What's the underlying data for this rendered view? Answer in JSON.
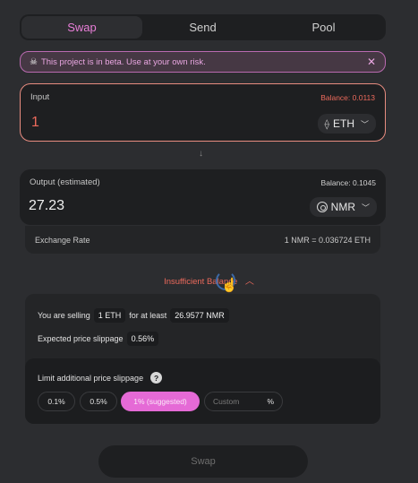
{
  "tabs": [
    {
      "label": "Swap",
      "active": true
    },
    {
      "label": "Send",
      "active": false
    },
    {
      "label": "Pool",
      "active": false
    }
  ],
  "beta_banner": {
    "icon": "skull-icon",
    "text": "This project is in beta. Use at your own risk.",
    "close": "✕"
  },
  "input": {
    "label": "Input",
    "balance": "Balance: 0.0113",
    "amount": "1",
    "token": "ETH"
  },
  "output": {
    "label": "Output (estimated)",
    "balance": "Balance: 0.1045",
    "amount": "27.23",
    "token": "NMR"
  },
  "exchange_rate": {
    "label": "Exchange Rate",
    "value": "1 NMR = 0.036724 ETH"
  },
  "status": {
    "text": "Insufficient Balance"
  },
  "details": {
    "selling_prefix": "You are selling",
    "selling_amount": "1 ETH",
    "selling_middle": "for at least",
    "receive_amount": "26.9577 NMR",
    "slippage_label": "Expected price slippage",
    "slippage_value": "0.56%"
  },
  "limit_slippage": {
    "label": "Limit additional price slippage",
    "help": "?",
    "options": [
      "0.1%",
      "0.5%",
      "1% (suggested)"
    ],
    "selected": "1% (suggested)",
    "custom_placeholder": "Custom",
    "custom_unit": "%"
  },
  "swap_button": "Swap",
  "colors": {
    "accent": "#e56ad6",
    "error": "#ec6a5c",
    "background": "#2c2d30",
    "panel": "#1e1f21"
  }
}
